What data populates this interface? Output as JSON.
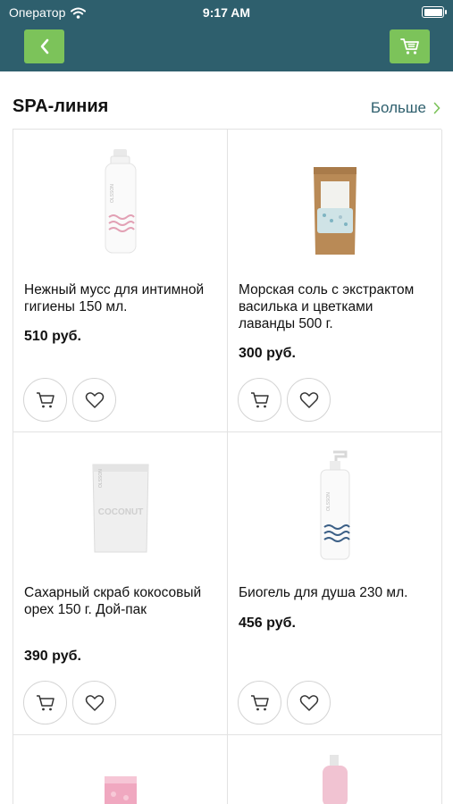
{
  "status_bar": {
    "carrier": "Оператор",
    "time": "9:17 AM"
  },
  "navigation": {
    "back_icon": "chevron-left-icon",
    "cart_icon": "cart-icon"
  },
  "section": {
    "title": "SPA-линия",
    "more_label": "Больше"
  },
  "products": [
    {
      "name": "Нежный мусс для интимной гигиены 150 мл.",
      "price": "510 руб."
    },
    {
      "name": "Морская соль с экстрактом василька и цветками лаванды 500 г.",
      "price": "300 руб."
    },
    {
      "name": "Сахарный скраб кокосовый орех 150 г. Дой-пак",
      "price": "390 руб."
    },
    {
      "name": "Биогель для душа 230 мл.",
      "price": "456 руб."
    },
    {
      "name": "",
      "price": ""
    },
    {
      "name": "",
      "price": ""
    }
  ],
  "product_labels": {
    "brand": "OLSSON",
    "coconut": "COCONUT"
  },
  "colors": {
    "header": "#2e5f6d",
    "accent_button": "#7cc35a",
    "link": "#2e5f6d",
    "border": "#e2e2e2"
  }
}
